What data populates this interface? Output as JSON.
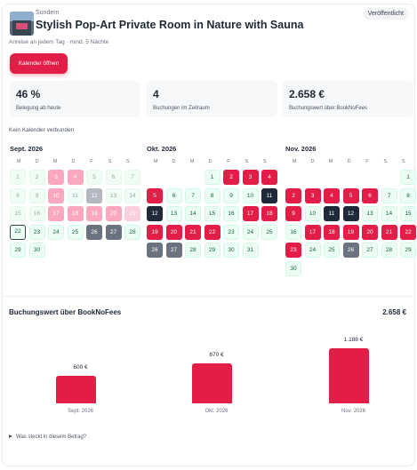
{
  "header": {
    "location": "Sundern",
    "title": "Stylish Pop-Art Private Room in Nature with Sauna",
    "status_badge": "Veröffentlicht",
    "subtitle": "Anreise an jedem Tag · mind. 5 Nächte",
    "calendar_button": "Kalender öffnen",
    "thumbnail_icon": "listing-photo"
  },
  "stats": [
    {
      "value": "46 %",
      "label": "Belegung ab heute"
    },
    {
      "value": "4",
      "label": "Buchungen im Zeitraum"
    },
    {
      "value": "2.658 €",
      "label": "Buchungswert über BookNoFees"
    }
  ],
  "no_calendar_text": "Kein Kalender verbunden",
  "weekday_labels": [
    "M",
    "D",
    "M",
    "D",
    "F",
    "S",
    "S"
  ],
  "calendar": {
    "months": [
      {
        "name": "Sept. 2026",
        "offset": 0,
        "days": [
          {
            "d": "1",
            "s": "pa"
          },
          {
            "d": "2",
            "s": "pa"
          },
          {
            "d": "3",
            "s": "pp"
          },
          {
            "d": "4",
            "s": "pp"
          },
          {
            "d": "5",
            "s": "pa"
          },
          {
            "d": "6",
            "s": "pa"
          },
          {
            "d": "7",
            "s": "pa"
          },
          {
            "d": "8",
            "s": "pa"
          },
          {
            "d": "9",
            "s": "pa"
          },
          {
            "d": "10",
            "s": "pp"
          },
          {
            "d": "11",
            "s": "pa"
          },
          {
            "d": "12",
            "s": "lg"
          },
          {
            "d": "13",
            "s": "pa"
          },
          {
            "d": "14",
            "s": "pa"
          },
          {
            "d": "15",
            "s": "pa"
          },
          {
            "d": "16",
            "s": "pa"
          },
          {
            "d": "17",
            "s": "pp"
          },
          {
            "d": "18",
            "s": "pp"
          },
          {
            "d": "19",
            "s": "pp"
          },
          {
            "d": "20",
            "s": "pp"
          },
          {
            "d": "21",
            "s": "lp"
          },
          {
            "d": "22",
            "s": "td"
          },
          {
            "d": "23",
            "s": "av"
          },
          {
            "d": "24",
            "s": "av"
          },
          {
            "d": "25",
            "s": "av"
          },
          {
            "d": "26",
            "s": "gr"
          },
          {
            "d": "27",
            "s": "gr"
          },
          {
            "d": "28",
            "s": "av"
          },
          {
            "d": "29",
            "s": "av"
          },
          {
            "d": "30",
            "s": "av"
          }
        ]
      },
      {
        "name": "Okt. 2026",
        "offset": 3,
        "days": [
          {
            "d": "1",
            "s": "av"
          },
          {
            "d": "2",
            "s": "bp"
          },
          {
            "d": "3",
            "s": "bp"
          },
          {
            "d": "4",
            "s": "bp"
          },
          {
            "d": "5",
            "s": "bp"
          },
          {
            "d": "6",
            "s": "av"
          },
          {
            "d": "7",
            "s": "av"
          },
          {
            "d": "8",
            "s": "av"
          },
          {
            "d": "9",
            "s": "av"
          },
          {
            "d": "10",
            "s": "av"
          },
          {
            "d": "11",
            "s": "bl"
          },
          {
            "d": "12",
            "s": "bl"
          },
          {
            "d": "13",
            "s": "av"
          },
          {
            "d": "14",
            "s": "av"
          },
          {
            "d": "15",
            "s": "av"
          },
          {
            "d": "16",
            "s": "av"
          },
          {
            "d": "17",
            "s": "bp"
          },
          {
            "d": "18",
            "s": "bp"
          },
          {
            "d": "19",
            "s": "bp"
          },
          {
            "d": "20",
            "s": "bp"
          },
          {
            "d": "21",
            "s": "bp"
          },
          {
            "d": "22",
            "s": "bp"
          },
          {
            "d": "23",
            "s": "av"
          },
          {
            "d": "24",
            "s": "av"
          },
          {
            "d": "25",
            "s": "av"
          },
          {
            "d": "26",
            "s": "gr"
          },
          {
            "d": "27",
            "s": "gr"
          },
          {
            "d": "28",
            "s": "av"
          },
          {
            "d": "29",
            "s": "av"
          },
          {
            "d": "30",
            "s": "av"
          },
          {
            "d": "31",
            "s": "av"
          }
        ]
      },
      {
        "name": "Nov. 2026",
        "offset": 6,
        "days": [
          {
            "d": "1",
            "s": "av"
          },
          {
            "d": "2",
            "s": "bp"
          },
          {
            "d": "3",
            "s": "bp"
          },
          {
            "d": "4",
            "s": "bp"
          },
          {
            "d": "5",
            "s": "bp"
          },
          {
            "d": "6",
            "s": "bp"
          },
          {
            "d": "7",
            "s": "av"
          },
          {
            "d": "8",
            "s": "av"
          },
          {
            "d": "9",
            "s": "bp"
          },
          {
            "d": "10",
            "s": "av"
          },
          {
            "d": "11",
            "s": "bl"
          },
          {
            "d": "12",
            "s": "bl"
          },
          {
            "d": "13",
            "s": "av"
          },
          {
            "d": "14",
            "s": "av"
          },
          {
            "d": "15",
            "s": "av"
          },
          {
            "d": "16",
            "s": "av"
          },
          {
            "d": "17",
            "s": "bp"
          },
          {
            "d": "18",
            "s": "bp"
          },
          {
            "d": "19",
            "s": "bp"
          },
          {
            "d": "20",
            "s": "bp"
          },
          {
            "d": "21",
            "s": "bp"
          },
          {
            "d": "22",
            "s": "bp"
          },
          {
            "d": "23",
            "s": "bp"
          },
          {
            "d": "24",
            "s": "av"
          },
          {
            "d": "25",
            "s": "av"
          },
          {
            "d": "26",
            "s": "gr"
          },
          {
            "d": "27",
            "s": "av"
          },
          {
            "d": "28",
            "s": "av"
          },
          {
            "d": "29",
            "s": "av"
          },
          {
            "d": "30",
            "s": "av"
          }
        ]
      }
    ]
  },
  "chart_section": {
    "title": "Buchungswert über BookNoFees",
    "total": "2.658 €"
  },
  "chart_data": {
    "type": "bar",
    "title": "Buchungswert über BookNoFees",
    "categories": [
      "Sept. 2026",
      "Okt. 2026",
      "Nov. 2026"
    ],
    "values": [
      600,
      870,
      1188
    ],
    "value_labels": [
      "600 €",
      "870 €",
      "1.188 €"
    ],
    "ylim": [
      0,
      1188
    ],
    "bar_color": "#e11d48"
  },
  "footer": {
    "details_toggle": "Was steckt in diesem Betrag?"
  },
  "colors": {
    "accent": "#e11d48",
    "available": "#ecfdf5",
    "booked": "#e11d48",
    "blocked": "#1f2937"
  }
}
